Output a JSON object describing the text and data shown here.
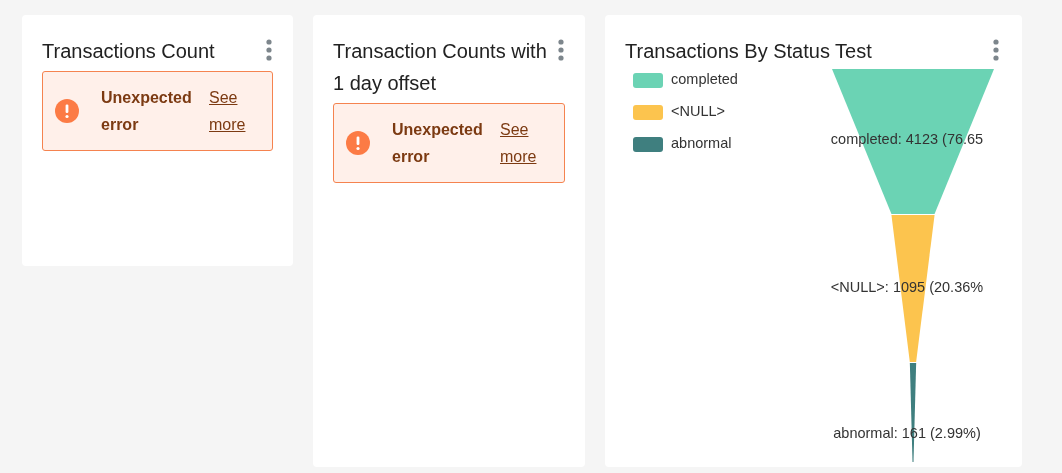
{
  "cards": [
    {
      "kind": "error",
      "title": "Transactions Count",
      "error": {
        "message": "Unexpected error",
        "link": "See more"
      }
    },
    {
      "kind": "error",
      "title": "Transaction Counts with 1 day offset",
      "error": {
        "message": "Unexpected error",
        "link": "See more"
      }
    },
    {
      "kind": "funnel",
      "title": "Transactions By Status Test",
      "legend": [
        {
          "label": "completed",
          "color": "#6bd3b4"
        },
        {
          "label": "<NULL>",
          "color": "#fcc44e"
        },
        {
          "label": "abnormal",
          "color": "#3f7f7f"
        }
      ],
      "stages": [
        {
          "label": "completed: 4123 (76.65",
          "color": "#6bd3b4"
        },
        {
          "label": "<NULL>: 1095 (20.36%",
          "color": "#fcc44e"
        },
        {
          "label": "abnormal: 161 (2.99%)",
          "color": "#3f7f7f"
        }
      ]
    }
  ]
}
